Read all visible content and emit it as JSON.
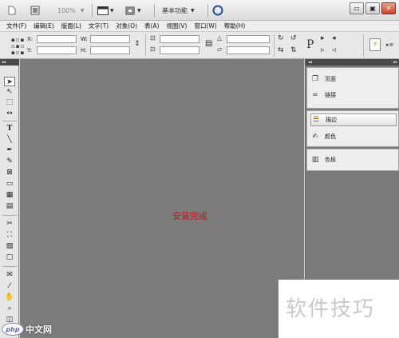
{
  "titlebar": {
    "zoom": "100%",
    "workspace": "基本功能",
    "minimize": "▭",
    "maximize": "▣",
    "close": "✕"
  },
  "menu": [
    "文件(F)",
    "编辑(E)",
    "版面(L)",
    "文字(T)",
    "对象(O)",
    "表(A)",
    "视图(V)",
    "窗口(W)",
    "帮助(H)"
  ],
  "control": {
    "x_label": "X:",
    "y_label": "Y:",
    "w_label": "W:",
    "h_label": "H:"
  },
  "canvas": {
    "message": "安装完成"
  },
  "panels": [
    {
      "label": "页面",
      "icon": "pages-icon"
    },
    {
      "label": "链接",
      "icon": "links-icon"
    },
    {
      "label": "描边",
      "icon": "stroke-icon"
    },
    {
      "label": "颜色",
      "icon": "color-icon"
    },
    {
      "label": "色板",
      "icon": "swatches-icon"
    }
  ],
  "watermark": {
    "text": "软件技巧",
    "logo_badge": "php",
    "logo_cn": "中文网"
  },
  "colors": {
    "canvas": "#7c7c7c",
    "message": "#c0141c"
  }
}
